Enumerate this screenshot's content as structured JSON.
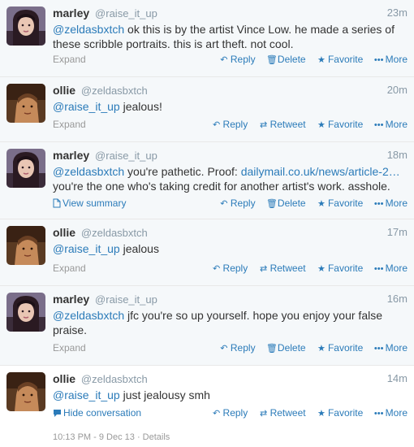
{
  "tweets": [
    {
      "fullname": "marley",
      "username": "@raise_it_up",
      "time": "23m",
      "avatar": "marley-avatar",
      "lines": [
        {
          "mention": "@zeldasbxtch",
          "text": " ok this is by the artist Vince Low. he made a series of"
        },
        {
          "mention": "",
          "text": "these scribble portraits. this is art theft. not cool."
        }
      ],
      "footer_left": "Expand",
      "actions": [
        "Reply",
        "Delete",
        "Favorite",
        "More"
      ]
    },
    {
      "fullname": "ollie",
      "username": "@zeldasbxtch",
      "time": "20m",
      "avatar": "ollie-avatar",
      "lines": [
        {
          "mention": "@raise_it_up",
          "text": " jealous!"
        }
      ],
      "footer_left": "Expand",
      "actions": [
        "Reply",
        "Retweet",
        "Favorite",
        "More"
      ]
    },
    {
      "fullname": "marley",
      "username": "@raise_it_up",
      "time": "18m",
      "avatar": "marley-avatar",
      "lines": [
        {
          "mention": "@zeldasbxtch",
          "text": " you're pathetic. Proof: ",
          "link": "dailymail.co.uk/news/article-2…"
        },
        {
          "mention": "",
          "text": "you're the one who's taking credit for another artist's work. asshole."
        }
      ],
      "footer_left": "View summary",
      "actions": [
        "Reply",
        "Delete",
        "Favorite",
        "More"
      ]
    },
    {
      "fullname": "ollie",
      "username": "@zeldasbxtch",
      "time": "17m",
      "avatar": "ollie-avatar",
      "lines": [
        {
          "mention": "@raise_it_up",
          "text": " jealous"
        }
      ],
      "footer_left": "Expand",
      "actions": [
        "Reply",
        "Retweet",
        "Favorite",
        "More"
      ]
    },
    {
      "fullname": "marley",
      "username": "@raise_it_up",
      "time": "16m",
      "avatar": "marley-avatar",
      "lines": [
        {
          "mention": "@zeldasbxtch",
          "text": " jfc you're so up yourself. hope you enjoy your false"
        },
        {
          "mention": "",
          "text": "praise."
        }
      ],
      "footer_left": "Expand",
      "actions": [
        "Reply",
        "Delete",
        "Favorite",
        "More"
      ]
    },
    {
      "fullname": "ollie",
      "username": "@zeldasbxtch",
      "time": "14m",
      "avatar": "ollie-avatar",
      "lines": [
        {
          "mention": "@raise_it_up",
          "text": " just jealousy smh"
        }
      ],
      "footer_left": "Hide conversation",
      "actions": [
        "Reply",
        "Retweet",
        "Favorite",
        "More"
      ]
    }
  ],
  "details_line": "10:13 PM - 9 Dec 13 · Details",
  "colors": {
    "link": "#2b7bb9",
    "muted": "#8899a6",
    "text": "#333333"
  }
}
